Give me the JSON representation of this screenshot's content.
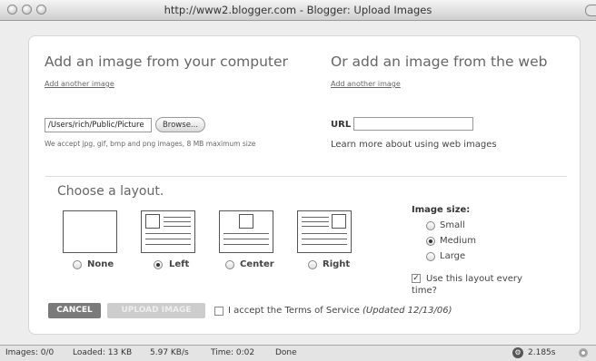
{
  "window": {
    "title": "http://www2.blogger.com - Blogger: Upload Images"
  },
  "upload": {
    "computer_heading": "Add an image from your computer",
    "add_another_left": "Add another image",
    "file_path": "/Users/rich/Public/Picture",
    "browse_label": "Browse...",
    "accept_note": "We accept jpg, gif, bmp and png images, 8 MB maximum size",
    "web_heading": "Or add an image from the web",
    "add_another_right": "Add another image",
    "url_label": "URL",
    "url_value": "",
    "learn_more": "Learn more about using web images"
  },
  "layout": {
    "heading": "Choose a layout.",
    "options": [
      {
        "label": "None",
        "selected": false
      },
      {
        "label": "Left",
        "selected": true
      },
      {
        "label": "Center",
        "selected": false
      },
      {
        "label": "Right",
        "selected": false
      }
    ],
    "image_size_title": "Image size:",
    "sizes": [
      {
        "label": "Small",
        "selected": false
      },
      {
        "label": "Medium",
        "selected": true
      },
      {
        "label": "Large",
        "selected": false
      }
    ],
    "use_layout_label": "Use this layout every time?",
    "use_layout_checked": true
  },
  "actions": {
    "cancel_label": "CANCEL",
    "upload_label": "UPLOAD IMAGE",
    "tos_prefix": "I accept the Terms of Service",
    "tos_updated": "(Updated 12/13/06)",
    "tos_checked": false
  },
  "statusbar": {
    "images": "Images: 0/0",
    "loaded": "Loaded: 13 KB",
    "speed": "5.97 KB/s",
    "time": "Time: 0:02",
    "status": "Done",
    "load_time": "2.185s"
  }
}
